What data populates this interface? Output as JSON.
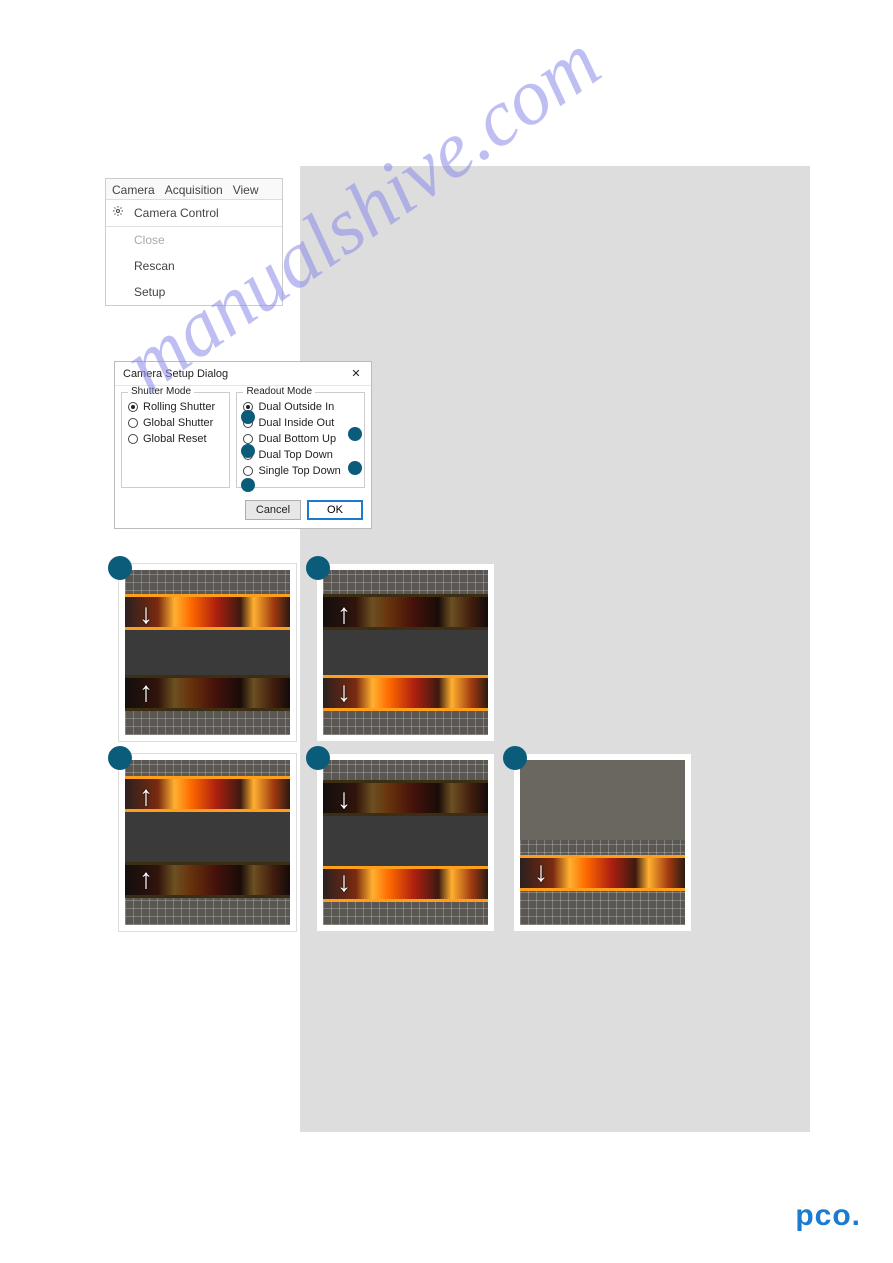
{
  "menu": {
    "items": [
      "Camera",
      "Acquisition",
      "View"
    ],
    "dropdown": {
      "camera_control": "Camera Control",
      "close": "Close",
      "rescan": "Rescan",
      "setup": "Setup"
    }
  },
  "dialog": {
    "title": "Camera Setup Dialog",
    "close_glyph": "✕",
    "shutter": {
      "legend": "Shutter Mode",
      "options": {
        "rolling": "Rolling Shutter",
        "global": "Global Shutter",
        "reset": "Global Reset"
      }
    },
    "readout": {
      "legend": "Readout Mode",
      "options": {
        "outside_in": "Dual Outside In",
        "inside_out": "Dual Inside Out",
        "bottom_up": "Dual Bottom Up",
        "top_down": "Dual Top Down",
        "single_top_down": "Single Top Down"
      }
    },
    "buttons": {
      "cancel": "Cancel",
      "ok": "OK"
    }
  },
  "arrows": {
    "up": "↑",
    "down": "↓"
  },
  "watermark_text": "manualshive.com",
  "brand": "pco."
}
